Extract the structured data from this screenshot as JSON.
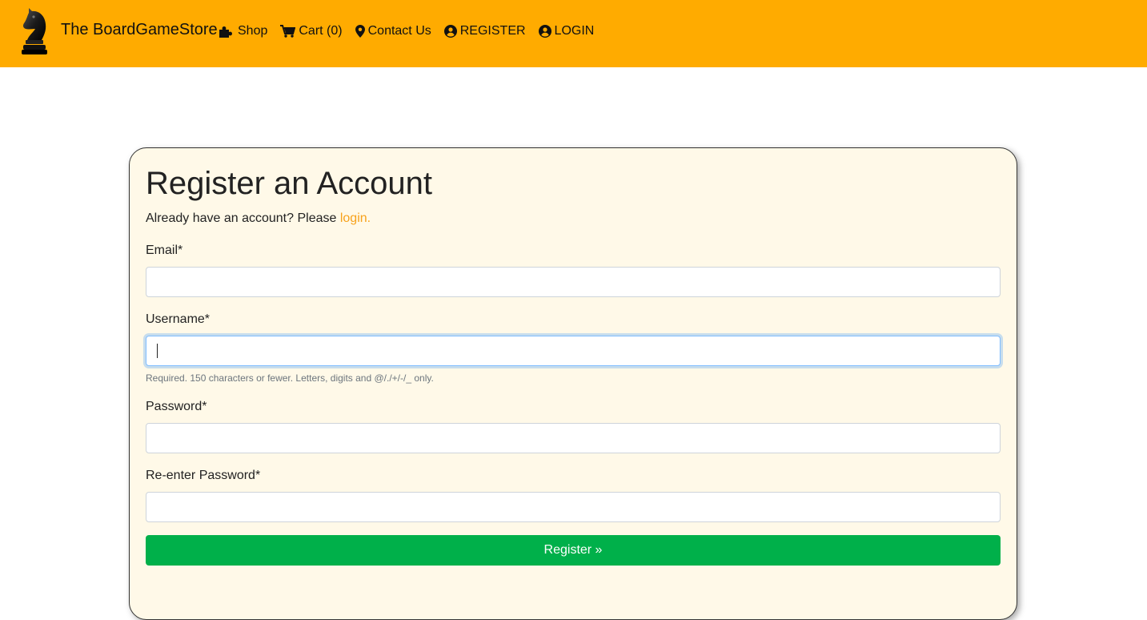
{
  "navbar": {
    "brand": "The BoardGameStore",
    "links": {
      "shop": "Shop",
      "cart": "Cart (0)",
      "contact": "Contact Us",
      "register": "REGISTER",
      "login": "LOGIN"
    },
    "background_color": "#ffab00",
    "icons": [
      "chess-knight-icon",
      "puzzle-icon",
      "cart-icon",
      "map-marker-icon",
      "user-circle-icon"
    ]
  },
  "form": {
    "title": "Register an Account",
    "already_text": "Already have an account? Please",
    "login_link": "login.",
    "email_label": "Email*",
    "email_value": "",
    "username_label": "Username*",
    "username_value": "",
    "username_help": "Required. 150 characters or fewer. Letters, digits and @/./+/-/_ only.",
    "password_label": "Password*",
    "password_value": "",
    "password2_label": "Re-enter Password*",
    "password2_value": "",
    "submit_label": "Register »",
    "accent_color": "#f7a21b",
    "submit_color": "#00b04a",
    "card_color": "#fff9e8"
  }
}
